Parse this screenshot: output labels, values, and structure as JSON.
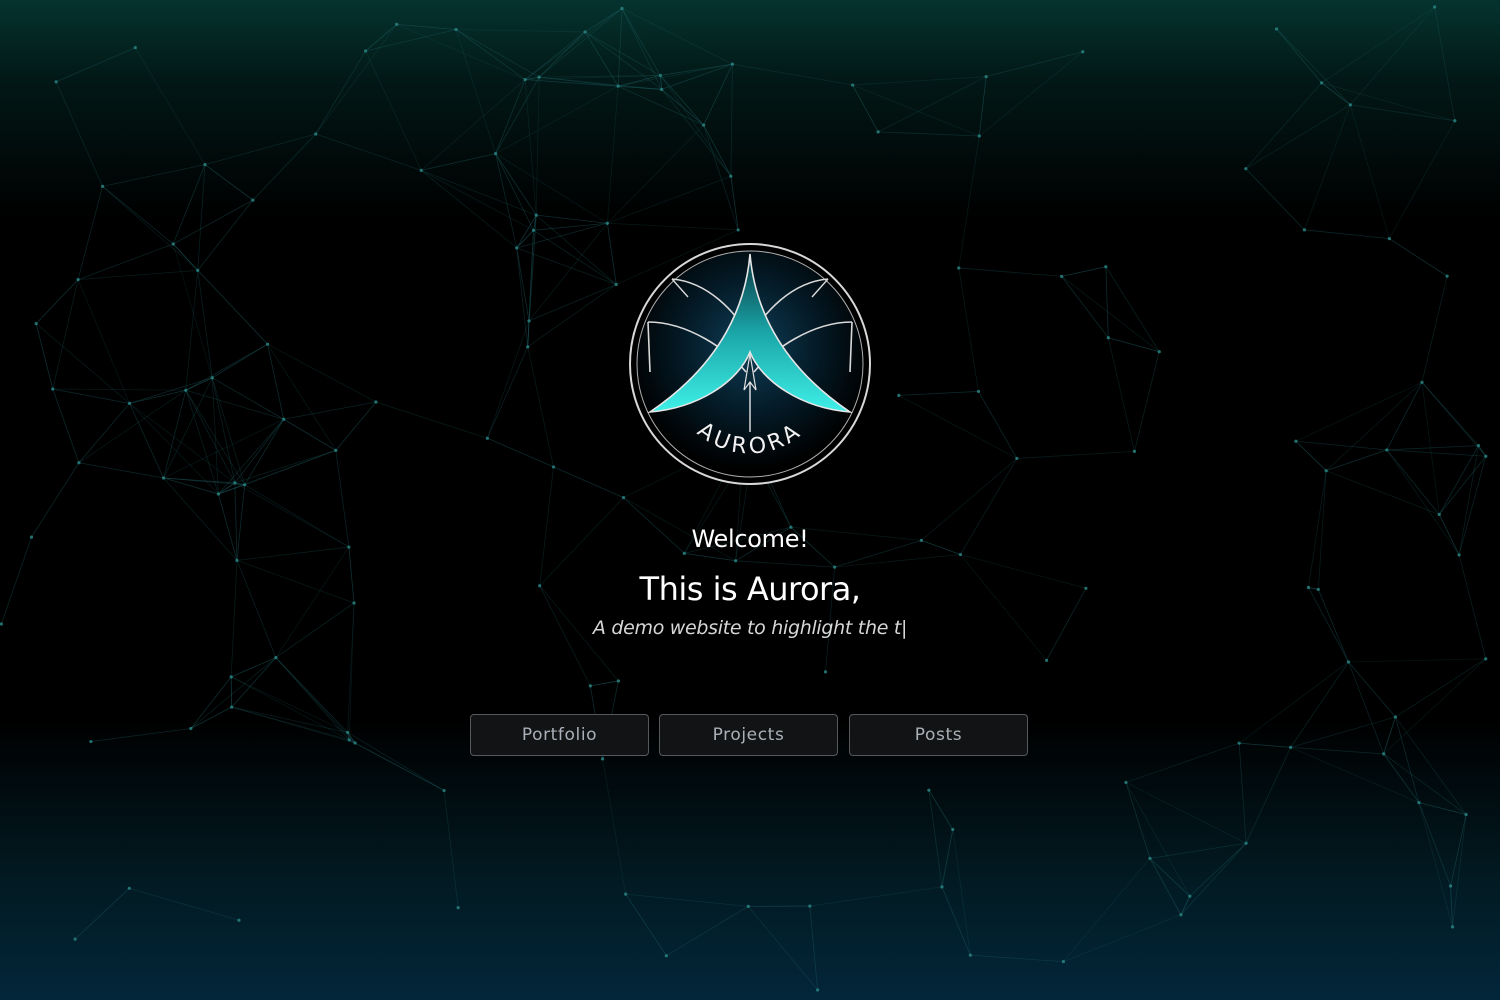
{
  "brand": {
    "logo_text": "AURORA",
    "accent_color": "#2ad7d2"
  },
  "hero": {
    "welcome": "Welcome!",
    "title": "This is Aurora,",
    "subtitle": "A demo website to highlight the t|"
  },
  "nav": {
    "buttons": [
      {
        "label": "Portfolio"
      },
      {
        "label": "Projects"
      },
      {
        "label": "Posts"
      }
    ]
  },
  "background": {
    "effect": "particle-network",
    "line_color": "#1d5a5e",
    "node_color": "#2a8a88"
  }
}
